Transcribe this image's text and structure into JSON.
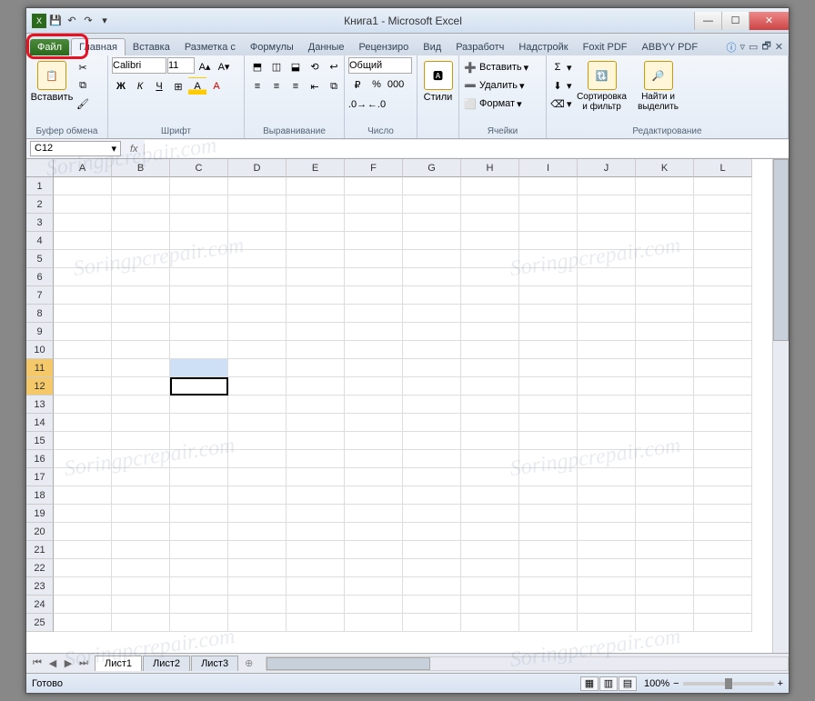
{
  "title": "Книга1 - Microsoft Excel",
  "tabs": {
    "file": "Файл",
    "home": "Главная",
    "insert": "Вставка",
    "layout": "Разметка с",
    "formulas": "Формулы",
    "data": "Данные",
    "review": "Рецензиро",
    "view": "Вид",
    "developer": "Разработч",
    "addins": "Надстройк",
    "foxit": "Foxit PDF",
    "abbyy": "ABBYY PDF"
  },
  "ribbon": {
    "clipboard": {
      "paste": "Вставить",
      "label": "Буфер обмена"
    },
    "font": {
      "name": "Calibri",
      "size": "11",
      "label": "Шрифт"
    },
    "alignment": {
      "label": "Выравнивание"
    },
    "number": {
      "format": "Общий",
      "label": "Число"
    },
    "styles": {
      "btn": "Стили",
      "label": ""
    },
    "cells": {
      "insert": "Вставить",
      "delete": "Удалить",
      "format": "Формат",
      "label": "Ячейки"
    },
    "editing": {
      "sort": "Сортировка и фильтр",
      "find": "Найти и выделить",
      "label": "Редактирование"
    }
  },
  "namebox": "C12",
  "columns": [
    "A",
    "B",
    "C",
    "D",
    "E",
    "F",
    "G",
    "H",
    "I",
    "J",
    "K",
    "L"
  ],
  "rows": [
    "1",
    "2",
    "3",
    "4",
    "5",
    "6",
    "7",
    "8",
    "9",
    "10",
    "11",
    "12",
    "13",
    "14",
    "15",
    "16",
    "17",
    "18",
    "19",
    "20",
    "21",
    "22",
    "23",
    "24",
    "25"
  ],
  "selected_rows": [
    11,
    12
  ],
  "sheets": {
    "s1": "Лист1",
    "s2": "Лист2",
    "s3": "Лист3"
  },
  "status": "Готово",
  "zoom": "100%",
  "watermark": "Soringpcrepair.com"
}
